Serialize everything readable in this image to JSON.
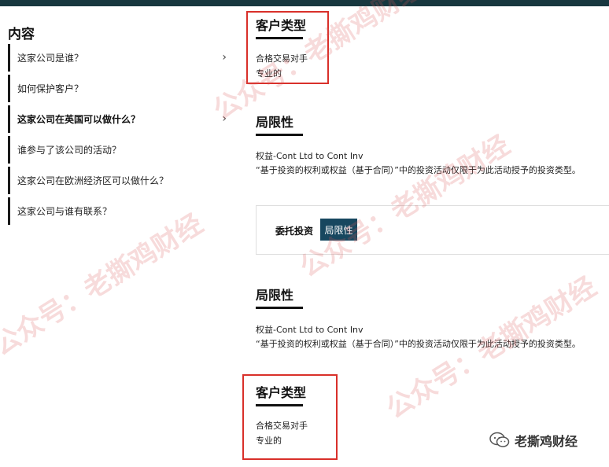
{
  "sidebar": {
    "title": "内容",
    "items": [
      {
        "label": "这家公司是谁？",
        "chevron": true
      },
      {
        "label": "如何保护客户？",
        "chevron": false
      },
      {
        "label": "这家公司在英国可以做什么？",
        "chevron": true
      },
      {
        "label": "谁参与了该公司的活动？",
        "chevron": false
      },
      {
        "label": "这家公司在欧洲经济区可以做什么？",
        "chevron": false
      },
      {
        "label": "这家公司与谁有联系？",
        "chevron": false
      }
    ]
  },
  "main": {
    "client_type_1": {
      "heading": "客户类型",
      "line1": "合格交易对手",
      "line2": "专业的"
    },
    "limitation_1": {
      "heading": "局限性",
      "line1": "权益-Cont Ltd to Cont Inv",
      "line2": "“基于投资的权利或权益（基于合同）”中的投资活动仅限于为此活动授予的投资类型。"
    },
    "tabs": {
      "inactive": "委托投资",
      "active": "局限性"
    },
    "limitation_2": {
      "heading": "局限性",
      "line1": "权益-Cont Ltd to Cont Inv",
      "line2": "“基于投资的权利或权益（基于合同）”中的投资活动仅限于为此活动授予的投资类型。"
    },
    "client_type_2": {
      "heading": "客户类型",
      "line1": "合格交易对手",
      "line2": "专业的"
    }
  },
  "watermark": {
    "text": "公众号：老撕鸡财经",
    "brand": "老撕鸡财经"
  },
  "colors": {
    "topbar": "#17373f",
    "active_tab": "#17475f",
    "highlight_box": "#d9302a"
  }
}
